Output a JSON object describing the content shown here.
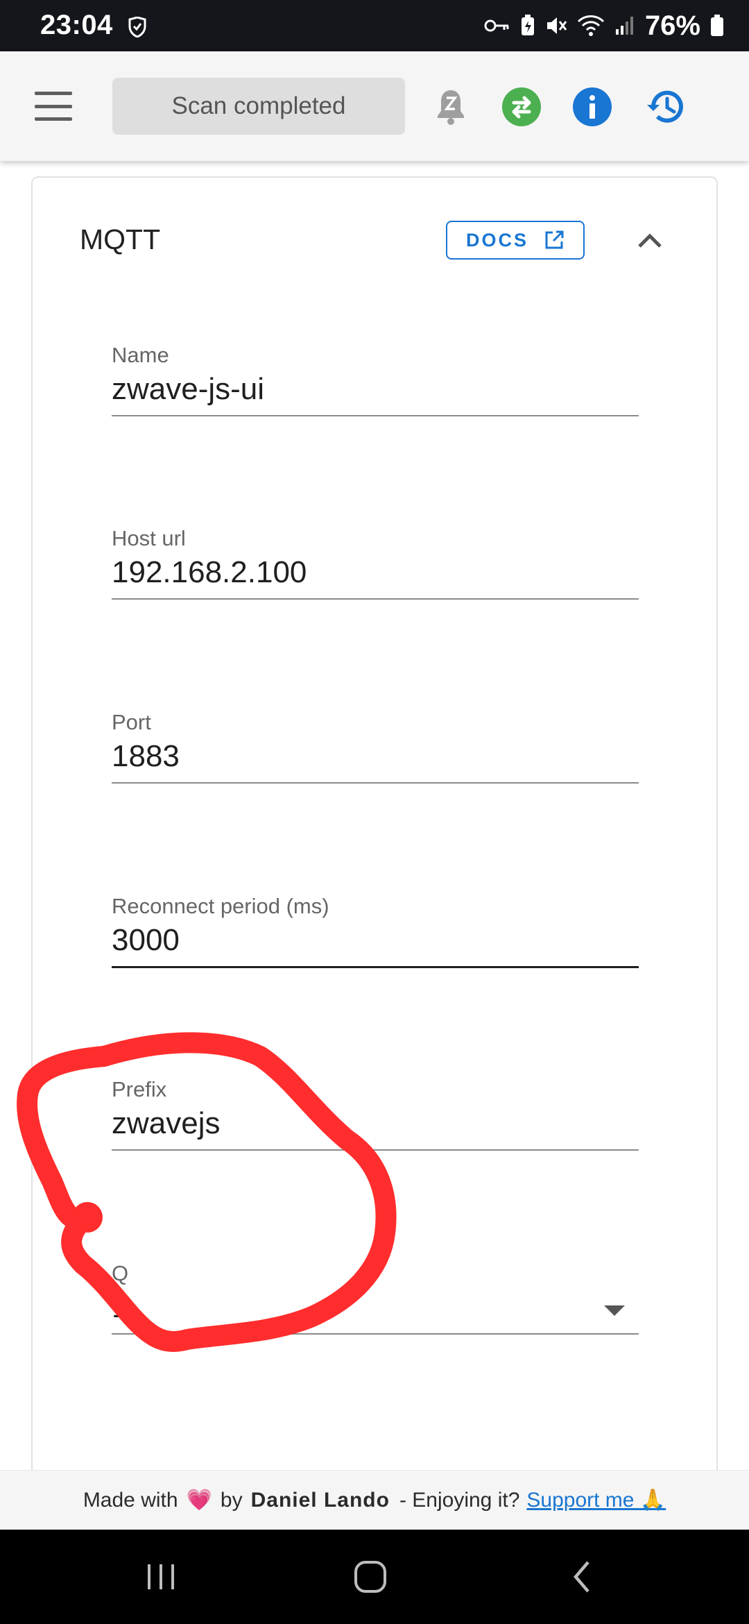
{
  "status_bar": {
    "time": "23:04",
    "battery_percent": "76%",
    "icons": [
      "shield-icon",
      "key-icon",
      "battery-saver-icon",
      "mute-icon",
      "wifi-icon",
      "signal-icon",
      "battery-icon"
    ]
  },
  "app_bar": {
    "menu_icon": "menu-icon",
    "status_chip": "Scan completed",
    "actions": [
      "notification-z-icon",
      "swap-icon",
      "info-icon",
      "history-icon"
    ],
    "colors": {
      "swap": "#4caf50",
      "info": "#1976d2",
      "history": "#1976d2",
      "bell": "#9e9e9e"
    }
  },
  "mqtt_card": {
    "title": "MQTT",
    "docs_label": "DOCS",
    "fields": [
      {
        "label": "Name",
        "value": "zwave-js-ui"
      },
      {
        "label": "Host url",
        "value": "192.168.2.100"
      },
      {
        "label": "Port",
        "value": "1883"
      },
      {
        "label": "Reconnect period (ms)",
        "value": "3000"
      },
      {
        "label": "Prefix",
        "value": "zwavejs"
      },
      {
        "label": "Q",
        "value": "1"
      }
    ]
  },
  "annotation": {
    "color": "#ff2d2d"
  },
  "footer": {
    "made_with": "Made with",
    "heart": "💗",
    "by": "by",
    "author": "Daniel Lando",
    "enjoying": "- Enjoying it?",
    "support_label": "Support me 🙏"
  },
  "accent_color": "#1976d2"
}
